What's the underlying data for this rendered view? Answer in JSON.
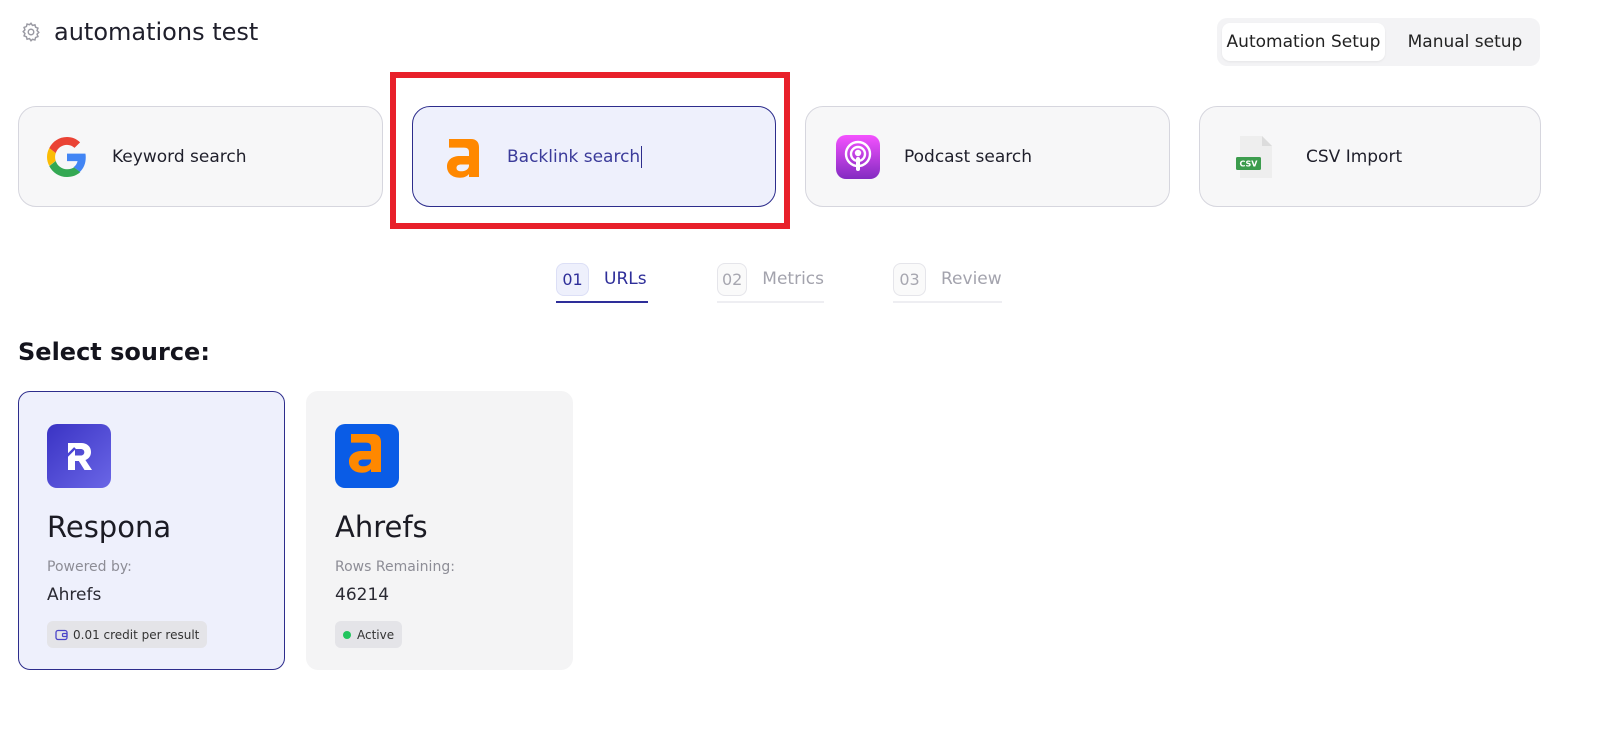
{
  "header": {
    "title": "automations test"
  },
  "setup_toggle": {
    "automation_label": "Automation Setup",
    "manual_label": "Manual setup",
    "selected": "automation"
  },
  "search_types": [
    {
      "label": "Keyword search",
      "icon": "google-icon"
    },
    {
      "label": "Backlink search",
      "icon": "ahrefs-icon",
      "selected": true
    },
    {
      "label": "Podcast search",
      "icon": "podcast-icon"
    },
    {
      "label": "CSV Import",
      "icon": "csv-file-icon"
    }
  ],
  "steps": [
    {
      "num": "01",
      "label": "URLs",
      "active": true
    },
    {
      "num": "02",
      "label": "Metrics",
      "active": false
    },
    {
      "num": "03",
      "label": "Review",
      "active": false
    }
  ],
  "section_title": "Select source:",
  "sources": [
    {
      "name": "Respona",
      "key": "Powered by:",
      "value": "Ahrefs",
      "tag": "0.01 credit per result",
      "icon": "respona-logo-icon",
      "selected": true
    },
    {
      "name": "Ahrefs",
      "key": "Rows Remaining:",
      "value": "46214",
      "tag": "Active",
      "icon": "ahrefs-logo-icon",
      "selected": false
    }
  ],
  "colors": {
    "accent": "#2e2e99",
    "selected_bg": "#eef0fc",
    "highlight": "#e8202a",
    "active_dot": "#22c55e",
    "ahrefs_orange": "#ff8800",
    "ahrefs_blue": "#0a5ce6"
  }
}
